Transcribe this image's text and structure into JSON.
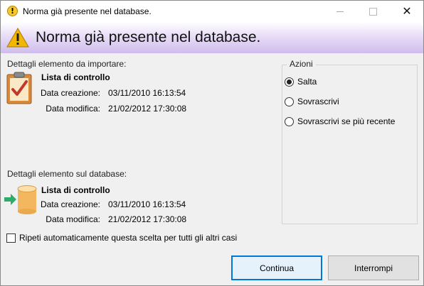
{
  "window": {
    "title": "Norma già presente nel database.",
    "title_icon": "exclamation-icon",
    "close_glyph": "✕"
  },
  "banner": {
    "title": "Norma già presente nel database.",
    "icon": "warning-triangle-icon",
    "accent_color": "#cfbdec"
  },
  "import_item": {
    "section_label": "Dettagli elemento da importare:",
    "icon": "clipboard-check-icon",
    "name": "Lista di controllo",
    "created_label": "Data creazione:",
    "created_value": "03/11/2010 16:13:54",
    "modified_label": "Data modifica:",
    "modified_value": "21/02/2012 17:30:08"
  },
  "database_item": {
    "section_label": "Dettagli elemento sul database:",
    "icon": "database-arrow-icon",
    "name": "Lista di controllo",
    "created_label": "Data creazione:",
    "created_value": "03/11/2010 16:13:54",
    "modified_label": "Data modifica:",
    "modified_value": "21/02/2012 17:30:08"
  },
  "actions": {
    "legend": "Azioni",
    "options": [
      {
        "label": "Salta",
        "checked": true
      },
      {
        "label": "Sovrascrivi",
        "checked": false
      },
      {
        "label": "Sovrascrivi se più recente",
        "checked": false
      }
    ]
  },
  "repeat_checkbox": {
    "label": "Ripeti automaticamente questa scelta per tutti gli altri casi",
    "checked": false
  },
  "buttons": {
    "continue": "Continua",
    "abort": "Interrompi"
  }
}
